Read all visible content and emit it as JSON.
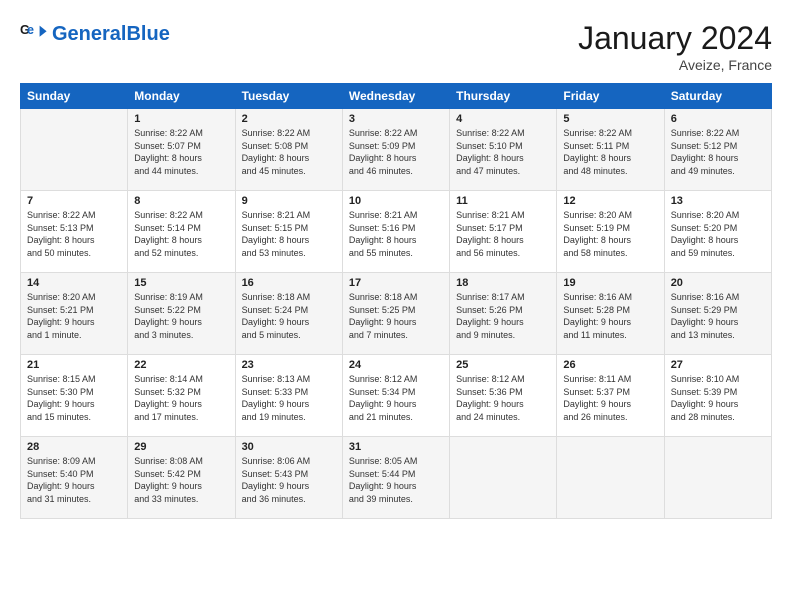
{
  "header": {
    "logo_general": "General",
    "logo_blue": "Blue",
    "month_title": "January 2024",
    "location": "Aveize, France"
  },
  "days_of_week": [
    "Sunday",
    "Monday",
    "Tuesday",
    "Wednesday",
    "Thursday",
    "Friday",
    "Saturday"
  ],
  "weeks": [
    [
      {
        "day": "",
        "lines": []
      },
      {
        "day": "1",
        "lines": [
          "Sunrise: 8:22 AM",
          "Sunset: 5:07 PM",
          "Daylight: 8 hours",
          "and 44 minutes."
        ]
      },
      {
        "day": "2",
        "lines": [
          "Sunrise: 8:22 AM",
          "Sunset: 5:08 PM",
          "Daylight: 8 hours",
          "and 45 minutes."
        ]
      },
      {
        "day": "3",
        "lines": [
          "Sunrise: 8:22 AM",
          "Sunset: 5:09 PM",
          "Daylight: 8 hours",
          "and 46 minutes."
        ]
      },
      {
        "day": "4",
        "lines": [
          "Sunrise: 8:22 AM",
          "Sunset: 5:10 PM",
          "Daylight: 8 hours",
          "and 47 minutes."
        ]
      },
      {
        "day": "5",
        "lines": [
          "Sunrise: 8:22 AM",
          "Sunset: 5:11 PM",
          "Daylight: 8 hours",
          "and 48 minutes."
        ]
      },
      {
        "day": "6",
        "lines": [
          "Sunrise: 8:22 AM",
          "Sunset: 5:12 PM",
          "Daylight: 8 hours",
          "and 49 minutes."
        ]
      }
    ],
    [
      {
        "day": "7",
        "lines": [
          "Sunrise: 8:22 AM",
          "Sunset: 5:13 PM",
          "Daylight: 8 hours",
          "and 50 minutes."
        ]
      },
      {
        "day": "8",
        "lines": [
          "Sunrise: 8:22 AM",
          "Sunset: 5:14 PM",
          "Daylight: 8 hours",
          "and 52 minutes."
        ]
      },
      {
        "day": "9",
        "lines": [
          "Sunrise: 8:21 AM",
          "Sunset: 5:15 PM",
          "Daylight: 8 hours",
          "and 53 minutes."
        ]
      },
      {
        "day": "10",
        "lines": [
          "Sunrise: 8:21 AM",
          "Sunset: 5:16 PM",
          "Daylight: 8 hours",
          "and 55 minutes."
        ]
      },
      {
        "day": "11",
        "lines": [
          "Sunrise: 8:21 AM",
          "Sunset: 5:17 PM",
          "Daylight: 8 hours",
          "and 56 minutes."
        ]
      },
      {
        "day": "12",
        "lines": [
          "Sunrise: 8:20 AM",
          "Sunset: 5:19 PM",
          "Daylight: 8 hours",
          "and 58 minutes."
        ]
      },
      {
        "day": "13",
        "lines": [
          "Sunrise: 8:20 AM",
          "Sunset: 5:20 PM",
          "Daylight: 8 hours",
          "and 59 minutes."
        ]
      }
    ],
    [
      {
        "day": "14",
        "lines": [
          "Sunrise: 8:20 AM",
          "Sunset: 5:21 PM",
          "Daylight: 9 hours",
          "and 1 minute."
        ]
      },
      {
        "day": "15",
        "lines": [
          "Sunrise: 8:19 AM",
          "Sunset: 5:22 PM",
          "Daylight: 9 hours",
          "and 3 minutes."
        ]
      },
      {
        "day": "16",
        "lines": [
          "Sunrise: 8:18 AM",
          "Sunset: 5:24 PM",
          "Daylight: 9 hours",
          "and 5 minutes."
        ]
      },
      {
        "day": "17",
        "lines": [
          "Sunrise: 8:18 AM",
          "Sunset: 5:25 PM",
          "Daylight: 9 hours",
          "and 7 minutes."
        ]
      },
      {
        "day": "18",
        "lines": [
          "Sunrise: 8:17 AM",
          "Sunset: 5:26 PM",
          "Daylight: 9 hours",
          "and 9 minutes."
        ]
      },
      {
        "day": "19",
        "lines": [
          "Sunrise: 8:16 AM",
          "Sunset: 5:28 PM",
          "Daylight: 9 hours",
          "and 11 minutes."
        ]
      },
      {
        "day": "20",
        "lines": [
          "Sunrise: 8:16 AM",
          "Sunset: 5:29 PM",
          "Daylight: 9 hours",
          "and 13 minutes."
        ]
      }
    ],
    [
      {
        "day": "21",
        "lines": [
          "Sunrise: 8:15 AM",
          "Sunset: 5:30 PM",
          "Daylight: 9 hours",
          "and 15 minutes."
        ]
      },
      {
        "day": "22",
        "lines": [
          "Sunrise: 8:14 AM",
          "Sunset: 5:32 PM",
          "Daylight: 9 hours",
          "and 17 minutes."
        ]
      },
      {
        "day": "23",
        "lines": [
          "Sunrise: 8:13 AM",
          "Sunset: 5:33 PM",
          "Daylight: 9 hours",
          "and 19 minutes."
        ]
      },
      {
        "day": "24",
        "lines": [
          "Sunrise: 8:12 AM",
          "Sunset: 5:34 PM",
          "Daylight: 9 hours",
          "and 21 minutes."
        ]
      },
      {
        "day": "25",
        "lines": [
          "Sunrise: 8:12 AM",
          "Sunset: 5:36 PM",
          "Daylight: 9 hours",
          "and 24 minutes."
        ]
      },
      {
        "day": "26",
        "lines": [
          "Sunrise: 8:11 AM",
          "Sunset: 5:37 PM",
          "Daylight: 9 hours",
          "and 26 minutes."
        ]
      },
      {
        "day": "27",
        "lines": [
          "Sunrise: 8:10 AM",
          "Sunset: 5:39 PM",
          "Daylight: 9 hours",
          "and 28 minutes."
        ]
      }
    ],
    [
      {
        "day": "28",
        "lines": [
          "Sunrise: 8:09 AM",
          "Sunset: 5:40 PM",
          "Daylight: 9 hours",
          "and 31 minutes."
        ]
      },
      {
        "day": "29",
        "lines": [
          "Sunrise: 8:08 AM",
          "Sunset: 5:42 PM",
          "Daylight: 9 hours",
          "and 33 minutes."
        ]
      },
      {
        "day": "30",
        "lines": [
          "Sunrise: 8:06 AM",
          "Sunset: 5:43 PM",
          "Daylight: 9 hours",
          "and 36 minutes."
        ]
      },
      {
        "day": "31",
        "lines": [
          "Sunrise: 8:05 AM",
          "Sunset: 5:44 PM",
          "Daylight: 9 hours",
          "and 39 minutes."
        ]
      },
      {
        "day": "",
        "lines": []
      },
      {
        "day": "",
        "lines": []
      },
      {
        "day": "",
        "lines": []
      }
    ]
  ]
}
